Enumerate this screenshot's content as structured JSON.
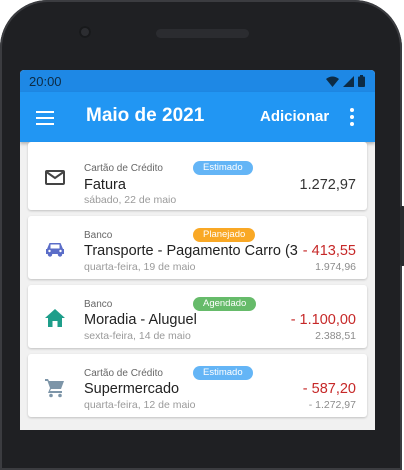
{
  "status_bar": {
    "time": "20:00"
  },
  "appbar": {
    "title": "Maio de 2021",
    "action": "Adicionar"
  },
  "colors": {
    "primary": "#2196f3",
    "status_bar": "#1e88e5",
    "negative": "#c62828",
    "badge_estimado": "#64b5f6",
    "badge_planejado": "#f9a825",
    "badge_agendado": "#66bb6a"
  },
  "transactions": [
    {
      "account": "Cartão de Crédito",
      "badge": "Estimado",
      "name": "Fatura",
      "date": "sábado, 22 de maio",
      "amount": "1.272,97",
      "balance": "",
      "icon": "mail-icon"
    },
    {
      "account": "Banco",
      "badge": "Planejado",
      "name": "Transporte - Pagamento Carro (3",
      "date": "quarta-feira, 19 de maio",
      "amount": "- 413,55",
      "balance": "1.974,96",
      "icon": "car-icon"
    },
    {
      "account": "Banco",
      "badge": "Agendado",
      "name": "Moradia - Aluguel",
      "date": "sexta-feira, 14 de maio",
      "amount": "- 1.100,00",
      "balance": "2.388,51",
      "icon": "home-icon"
    },
    {
      "account": "Cartão de Crédito",
      "badge": "Estimado",
      "name": "Supermercado",
      "date": "quarta-feira, 12 de maio",
      "amount": "- 587,20",
      "balance": "- 1.272,97",
      "icon": "cart-icon"
    }
  ]
}
